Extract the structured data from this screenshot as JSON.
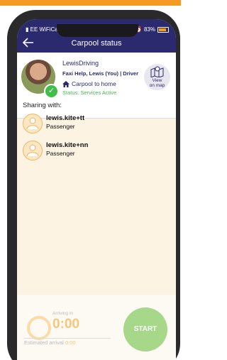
{
  "status_bar": {
    "carrier": "EE WiFiCa",
    "battery": "83%"
  },
  "header": {
    "title": "Carpool status"
  },
  "driver": {
    "group": "LewisDriving",
    "members": "Faxi Help, Lewis (You) | Driver",
    "destination": "Carpool to home",
    "status": "Status: Services Active"
  },
  "map_button": {
    "line1": "View",
    "line2": "on map"
  },
  "sharing": {
    "title": "Sharing with:",
    "passengers": [
      {
        "name": "lewis.kite+tt",
        "role": "Passenger"
      },
      {
        "name": "lewis.kite+nn",
        "role": "Passenger"
      }
    ]
  },
  "arrival": {
    "label": "Arriving in",
    "time": "0:00",
    "eta_label": "Estimated arrival",
    "eta_value": "0:00"
  },
  "start_button": {
    "label": "START"
  },
  "colors": {
    "brand": "#2c2a6e",
    "accent": "#f59a23",
    "success": "#3fbf4a",
    "start": "#a7d88a"
  }
}
